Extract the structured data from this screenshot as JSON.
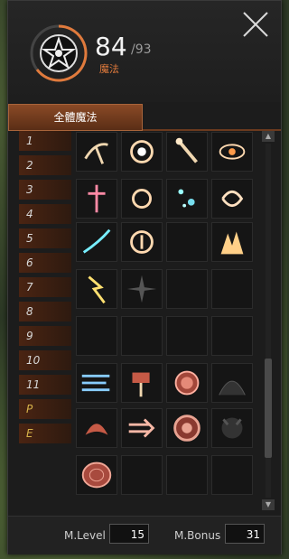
{
  "header": {
    "count": "84",
    "max": "/93",
    "sublabel": "魔法"
  },
  "tabs": [
    {
      "label": "全體魔法",
      "active": true
    },
    {
      "label": "",
      "active": false
    },
    {
      "label": "",
      "active": false
    }
  ],
  "rows": [
    "1",
    "2",
    "3",
    "4",
    "5",
    "6",
    "7",
    "8",
    "9",
    "10",
    "11",
    "P",
    "E"
  ],
  "footer": {
    "level_label": "M.Level",
    "level_value": "15",
    "bonus_label": "M.Bonus",
    "bonus_value": "31"
  },
  "colors": {
    "accent": "#e07a3c",
    "tab_active": "#8a4a26",
    "special_row": "#d6b24a"
  },
  "icons": [
    "pickaxe-icon",
    "vortex-icon",
    "torch-icon",
    "eye-icon",
    "holy-sword-icon",
    "fist-icon",
    "sparkle-icon",
    "spiral-icon",
    "wind-slash-icon",
    "shield-icon",
    "empty-slot",
    "flame-burst-icon",
    "lightning-icon",
    "dark-star-icon",
    "empty-slot",
    "empty-slot",
    "empty-slot",
    "empty-slot",
    "empty-slot",
    "empty-slot",
    "wind-lines-icon",
    "hammer-icon",
    "orb-shield-icon",
    "dark-wing-icon",
    "flame-armor-icon",
    "arrow-icon",
    "gear-shield-icon",
    "demon-icon",
    "rune-disc-icon",
    "empty-slot",
    "empty-slot",
    "empty-slot"
  ]
}
